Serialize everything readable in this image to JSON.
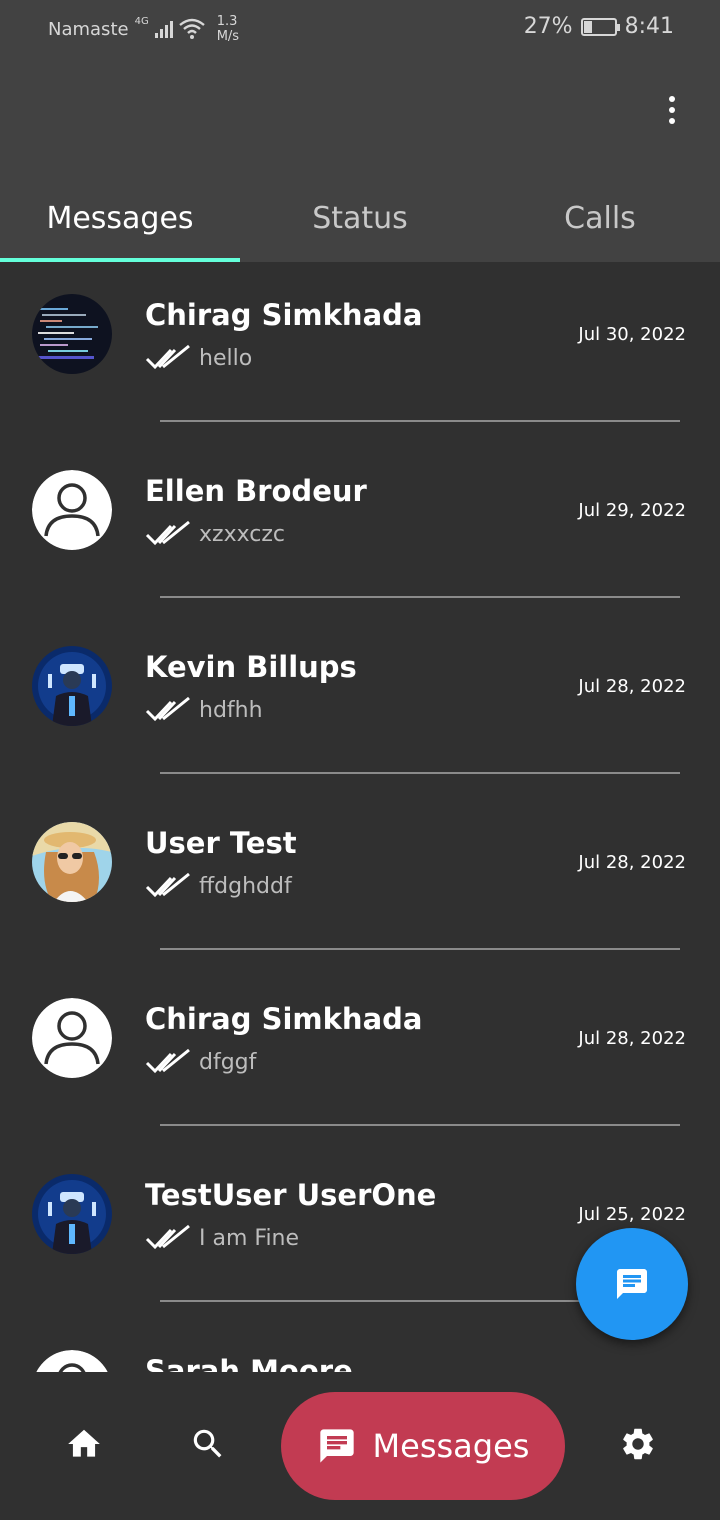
{
  "status_bar": {
    "carrier": "Namaste",
    "network": "4G",
    "speed_value": "1.3",
    "speed_unit": "M/s",
    "battery": "27%",
    "time": "8:41"
  },
  "tabs": [
    {
      "label": "Messages",
      "active": true
    },
    {
      "label": "Status",
      "active": false
    },
    {
      "label": "Calls",
      "active": false
    }
  ],
  "conversations": [
    {
      "name": "Chirag Simkhada",
      "message": "hello",
      "date": "Jul 30, 2022",
      "avatar": "code-photo"
    },
    {
      "name": "Ellen Brodeur",
      "message": "xzxxczc",
      "date": "Jul 29, 2022",
      "avatar": "default-person"
    },
    {
      "name": "Kevin Billups",
      "message": "hdfhh",
      "date": "Jul 28, 2022",
      "avatar": "vr-photo"
    },
    {
      "name": "User Test",
      "message": "ffdghddf",
      "date": "Jul 28, 2022",
      "avatar": "woman-photo"
    },
    {
      "name": "Chirag Simkhada",
      "message": "dfggf",
      "date": "Jul 28, 2022",
      "avatar": "default-person"
    },
    {
      "name": "TestUser UserOne",
      "message": "I am Fine",
      "date": "Jul 25, 2022",
      "avatar": "vr-photo"
    },
    {
      "name": "Sarah Moore",
      "message": "",
      "date": "",
      "avatar": "default-person"
    }
  ],
  "bottom_nav": {
    "active_label": "Messages",
    "items": [
      "home-icon",
      "search-icon",
      "message-icon",
      "settings-icon"
    ]
  },
  "colors": {
    "appbar": "#424242",
    "background": "#303030",
    "tab_indicator": "#64ffda",
    "fab": "#2196f3",
    "nav_pill": "#c23b52"
  }
}
